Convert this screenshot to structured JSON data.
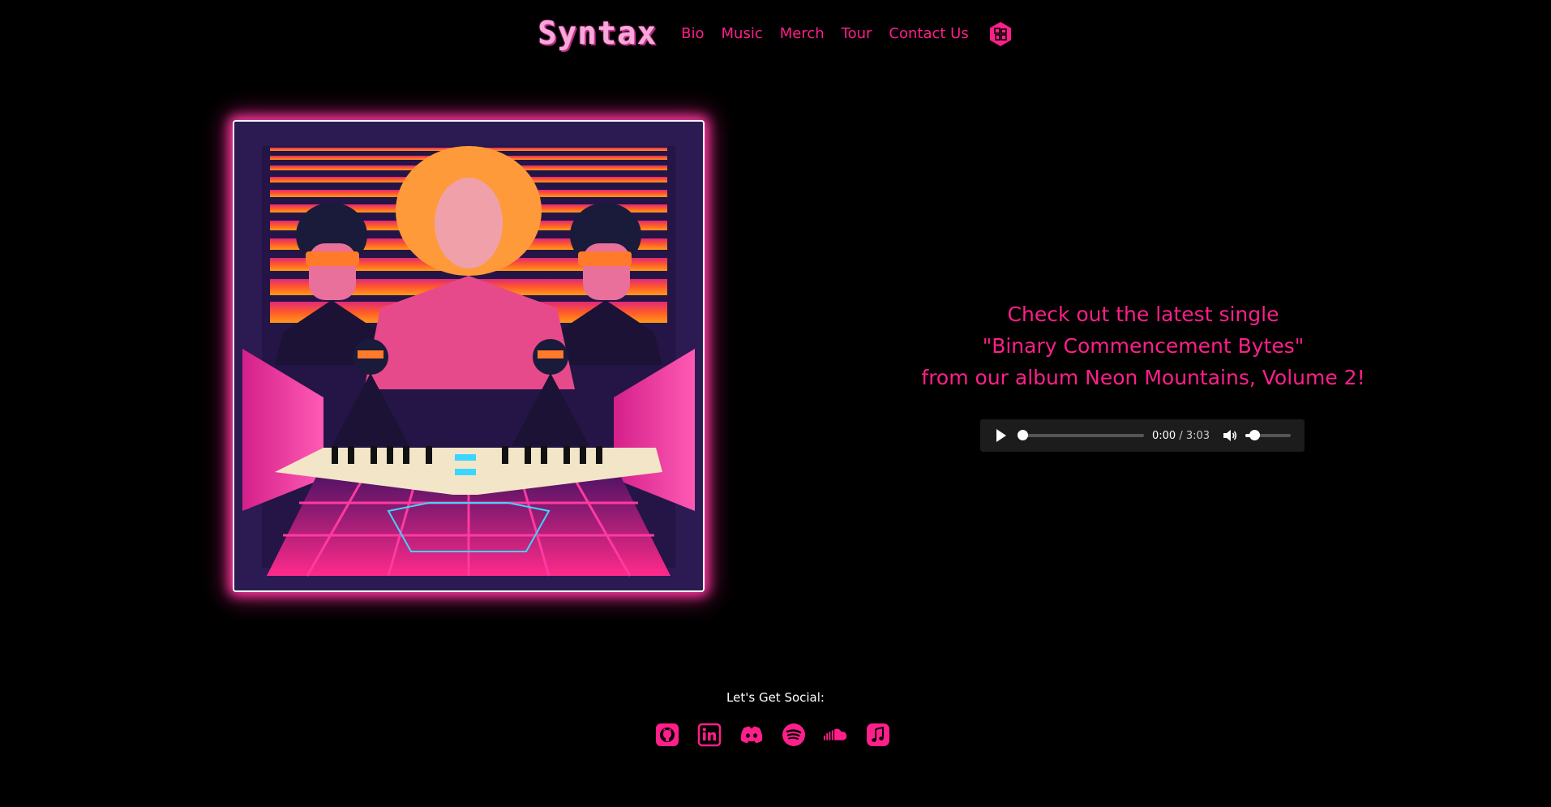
{
  "brand": {
    "name": "Syntax"
  },
  "nav": {
    "items": [
      {
        "label": "Bio"
      },
      {
        "label": "Music"
      },
      {
        "label": "Merch"
      },
      {
        "label": "Tour"
      },
      {
        "label": "Contact Us"
      }
    ],
    "extra_icon": "cube-logo-icon"
  },
  "album": {
    "art_icon": "album-cover-image"
  },
  "promo": {
    "line1": "Check out the latest single",
    "line2": "\"Binary Commencement Bytes\"",
    "line3": "from our album Neon Mountains, Volume 2!"
  },
  "player": {
    "current_time": "0:00",
    "separator": " / ",
    "duration": "3:03",
    "progress_fraction": 0.0,
    "volume_fraction": 0.2
  },
  "social": {
    "label": "Let's Get Social:",
    "icons": [
      "github-icon",
      "linkedin-icon",
      "discord-icon",
      "spotify-icon",
      "soundcloud-icon",
      "apple-music-icon"
    ]
  },
  "colors": {
    "background": "#000000",
    "accent": "#ff1f8a",
    "brand": "#f7a8d8"
  }
}
